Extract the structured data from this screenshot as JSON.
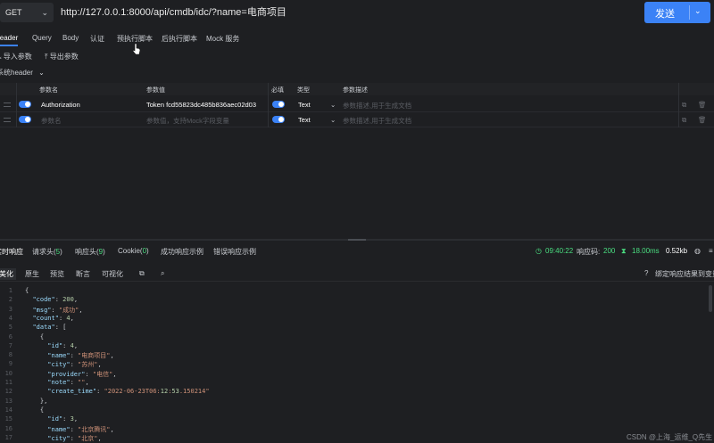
{
  "request": {
    "method": "GET",
    "url": "http://127.0.0.1:8000/api/cmdb/idc/?name=电商项目",
    "send_label": "发送"
  },
  "tabs": [
    "Header",
    "Query",
    "Body",
    "认证",
    "预执行脚本",
    "后执行脚本",
    "Mock 服务"
  ],
  "toolbar": {
    "import_label": "导入参数",
    "export_label": "导出参数",
    "system_header_label": "系统header"
  },
  "params_table": {
    "headers": [
      "参数名",
      "参数值",
      "必填",
      "类型",
      "参数描述"
    ],
    "rows": [
      {
        "name": "Authorization",
        "value": "Token fcd55823dc485b836aec02d03",
        "type": "Text",
        "description": "参数描述,用于生成文档"
      },
      {
        "name": "参数名",
        "value": "参数值，支持Mock字段变量",
        "type": "Text",
        "description": "参数描述,用于生成文档"
      }
    ]
  },
  "response": {
    "tabs": {
      "body": "实时响应",
      "req_headers": "请求头",
      "req_headers_count": "5",
      "resp_headers": "响应头",
      "resp_headers_count": "9",
      "cookie": "Cookie",
      "cookie_count": "0",
      "success_example": "成功响应示例",
      "error_example": "错误响应示例"
    },
    "time": "09:40:22",
    "status_label": "响应码:",
    "status_code": "200",
    "duration": "18.00ms",
    "size": "0.52kb",
    "view_tools": [
      "美化",
      "原生",
      "预览",
      "断言",
      "可视化"
    ],
    "bind_example_label": "绑定响应结果到变量"
  },
  "code_lines": [
    "{",
    "  \"code\": 200,",
    "  \"msg\": \"成功\",",
    "  \"count\": 4,",
    "  \"data\": [",
    "    {",
    "      \"id\": 4,",
    "      \"name\": \"电商项目\",",
    "      \"city\": \"苏州\",",
    "      \"provider\": \"电信\",",
    "      \"note\": \"\",",
    "      \"create_time\": \"2022-06-23T06:12:53.150214\"",
    "    },",
    "    {",
    "      \"id\": 3,",
    "      \"name\": \"北京腾讯\",",
    "      \"city\": \"北京\","
  ],
  "line_numbers": [
    "1",
    "2",
    "3",
    "4",
    "5",
    "6",
    "7",
    "8",
    "9",
    "10",
    "11",
    "12",
    "13",
    "14",
    "15",
    "16",
    "17"
  ],
  "watermark": "CSDN @上海_运维_Q先生",
  "colors": {
    "accent": "#3b82f6",
    "success": "#4ade80",
    "background": "#1e1f22"
  }
}
